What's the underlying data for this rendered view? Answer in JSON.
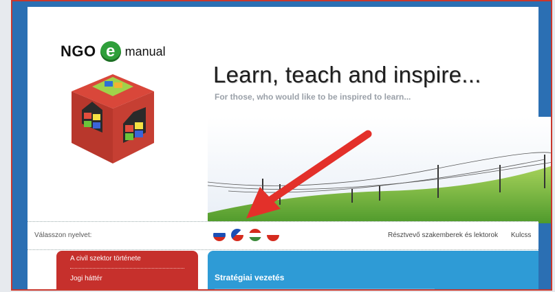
{
  "logo": {
    "left": "NGO",
    "mark": "e",
    "right": "manual"
  },
  "header": {
    "headline": "Learn, teach and inspire...",
    "tagline": "For those, who would like to be inspired to learn..."
  },
  "language_row": {
    "label": "Válasszon nyelvet:",
    "flags": [
      "slovakia-flag",
      "czech-flag",
      "hungary-flag",
      "poland-flag"
    ],
    "links": [
      "Résztvevő szakemberek és lektorok",
      "Kulcss"
    ]
  },
  "sidebar": {
    "items": [
      "A civil szektor története",
      "Jogi háttér"
    ]
  },
  "content": {
    "title": "Stratégiai vezetés"
  },
  "colors": {
    "frame": "#c9372c",
    "brand_blue": "#2b6fb3",
    "sidebar_red": "#c6302c",
    "content_blue": "#2e9bd6",
    "arrow": "#e3302a"
  }
}
